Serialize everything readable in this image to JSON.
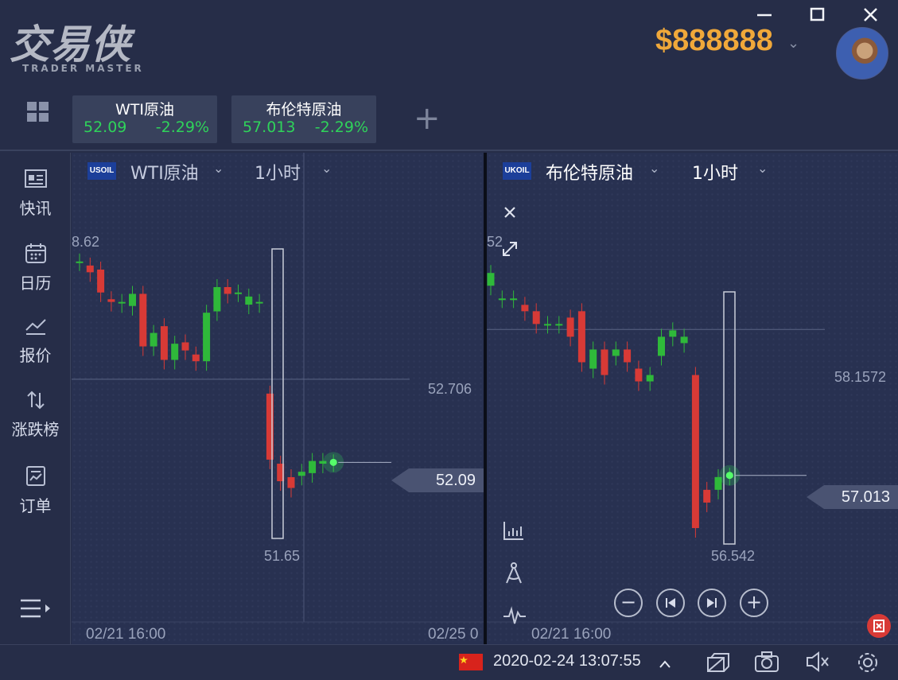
{
  "app": {
    "logo_cn": "交易侠",
    "logo_en": "TRADER MASTER",
    "balance": "$888888",
    "window_controls": [
      "minimize-icon",
      "maximize-icon",
      "close-icon"
    ]
  },
  "tabs": [
    {
      "name": "WTI原油",
      "price": "52.09",
      "change": "-2.29%"
    },
    {
      "name": "布伦特原油",
      "price": "57.013",
      "change": "-2.29%"
    }
  ],
  "sidebar": {
    "items": [
      {
        "label": "快讯",
        "icon": "news-icon"
      },
      {
        "label": "日历",
        "icon": "calendar-icon"
      },
      {
        "label": "报价",
        "icon": "quote-chart-icon"
      },
      {
        "label": "涨跌榜",
        "icon": "updown-icon"
      },
      {
        "label": "订单",
        "icon": "order-icon"
      }
    ],
    "menu_icon": "menu-expand-icon"
  },
  "charts": {
    "left": {
      "symbol_badge": "USOIL",
      "name": "WTI原油",
      "timeframe": "1小时",
      "high_label": "8.62",
      "crosshair_price": "52.706",
      "low_label": "51.65",
      "current_price": "52.09",
      "time_start": "02/21 16:00",
      "time_end": "02/25 0"
    },
    "right": {
      "symbol_badge": "UKOIL",
      "name": "布伦特原油",
      "timeframe": "1小时",
      "high_label": "52",
      "crosshair_price": "58.1572",
      "low_label": "56.542",
      "current_price": "57.013",
      "time_start": "02/21 16:00"
    }
  },
  "chart_data": [
    {
      "type": "candlestick",
      "title": "WTI原油",
      "timeframe": "1小时",
      "x_labels": [
        "02/21 16:00",
        "02/25 0"
      ],
      "candles": [
        {
          "o": 53.58,
          "c": 53.58,
          "dir": "up"
        },
        {
          "o": 53.55,
          "c": 53.5,
          "dir": "down"
        },
        {
          "o": 53.52,
          "c": 53.35,
          "dir": "down"
        },
        {
          "o": 53.3,
          "c": 53.28,
          "dir": "down"
        },
        {
          "o": 53.28,
          "c": 53.27,
          "dir": "flat"
        },
        {
          "o": 53.25,
          "c": 53.34,
          "dir": "up"
        },
        {
          "o": 53.34,
          "c": 52.95,
          "dir": "down"
        },
        {
          "o": 52.95,
          "c": 53.05,
          "dir": "up"
        },
        {
          "o": 53.1,
          "c": 52.85,
          "dir": "down"
        },
        {
          "o": 52.85,
          "c": 52.97,
          "dir": "up"
        },
        {
          "o": 52.98,
          "c": 52.92,
          "dir": "down"
        },
        {
          "o": 52.89,
          "c": 52.84,
          "dir": "down"
        },
        {
          "o": 52.84,
          "c": 53.2,
          "dir": "up"
        },
        {
          "o": 53.21,
          "c": 53.39,
          "dir": "up"
        },
        {
          "o": 53.39,
          "c": 53.34,
          "dir": "down"
        },
        {
          "o": 53.35,
          "c": 53.35,
          "dir": "flat"
        },
        {
          "o": 53.26,
          "c": 53.32,
          "dir": "up"
        },
        {
          "o": 53.28,
          "c": 53.27,
          "dir": "flat"
        },
        {
          "o": 52.6,
          "c": 52.11,
          "dir": "down"
        },
        {
          "o": 52.08,
          "c": 51.95,
          "dir": "down"
        },
        {
          "o": 51.98,
          "c": 51.9,
          "dir": "down"
        },
        {
          "o": 52.02,
          "c": 51.99,
          "dir": "flat"
        },
        {
          "o": 52.1,
          "c": 52.01,
          "dir": "up"
        },
        {
          "o": 52.1,
          "c": 52.08,
          "dir": "up"
        },
        {
          "o": 52.09,
          "c": 52.09,
          "dir": "flat"
        }
      ],
      "crosshair_price": 52.706,
      "range_low": 51.65,
      "current": 52.09
    },
    {
      "type": "candlestick",
      "title": "布伦特原油",
      "timeframe": "1小时",
      "x_labels": [
        "02/21 16:00"
      ],
      "candles": [
        {
          "o": 58.6,
          "c": 58.5,
          "dir": "up"
        },
        {
          "o": 58.4,
          "c": 58.4,
          "dir": "flat"
        },
        {
          "o": 58.4,
          "c": 58.4,
          "dir": "flat"
        },
        {
          "o": 58.35,
          "c": 58.3,
          "dir": "down"
        },
        {
          "o": 58.3,
          "c": 58.2,
          "dir": "down"
        },
        {
          "o": 58.2,
          "c": 58.2,
          "dir": "flat"
        },
        {
          "o": 58.2,
          "c": 58.2,
          "dir": "flat"
        },
        {
          "o": 58.25,
          "c": 58.1,
          "dir": "down"
        },
        {
          "o": 58.3,
          "c": 57.9,
          "dir": "down"
        },
        {
          "o": 57.85,
          "c": 58.0,
          "dir": "up"
        },
        {
          "o": 58.0,
          "c": 57.8,
          "dir": "down"
        },
        {
          "o": 57.95,
          "c": 58.0,
          "dir": "up"
        },
        {
          "o": 58.0,
          "c": 57.9,
          "dir": "down"
        },
        {
          "o": 57.85,
          "c": 57.75,
          "dir": "down"
        },
        {
          "o": 57.75,
          "c": 57.8,
          "dir": "up"
        },
        {
          "o": 57.95,
          "c": 58.1,
          "dir": "up"
        },
        {
          "o": 58.15,
          "c": 58.1,
          "dir": "up"
        },
        {
          "o": 58.1,
          "c": 58.05,
          "dir": "flat"
        },
        {
          "o": 57.8,
          "c": 56.6,
          "dir": "down"
        },
        {
          "o": 56.9,
          "c": 56.8,
          "dir": "down"
        },
        {
          "o": 56.9,
          "c": 57.0,
          "dir": "up"
        },
        {
          "o": 57.01,
          "c": 57.01,
          "dir": "flat"
        }
      ],
      "crosshair_price": 58.1572,
      "range_low": 56.542,
      "current": 57.013
    }
  ],
  "statusbar": {
    "datetime": "2020-02-24 13:07:55",
    "icons": [
      "flag-cn-icon",
      "caret-up-icon",
      "layers-icon",
      "camera-icon",
      "mute-icon",
      "settings-icon"
    ]
  },
  "colors": {
    "background": "#262d48",
    "chart_bg": "#283151",
    "up": "#2fb93a",
    "down": "#d83a36",
    "balance": "#f0a83a",
    "positive_text": "#2fd35a"
  }
}
